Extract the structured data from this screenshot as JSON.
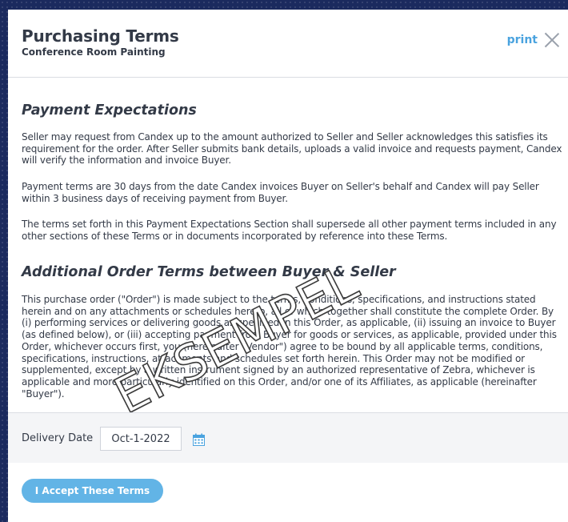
{
  "header": {
    "title": "Purchasing Terms",
    "subtitle": "Conference Room Painting",
    "print_label": "print"
  },
  "sections": [
    {
      "title": "Payment Expectations",
      "paragraphs": [
        "Seller may request from Candex up to the amount authorized to Seller and Seller acknowledges this satisfies its requirement for the order. After Seller submits bank details, uploads a valid invoice and requests payment, Candex will verify the information and invoice Buyer.",
        "Payment terms are 30 days from the date Candex invoices Buyer on Seller's behalf and Candex will pay Seller within 3 business days of receiving payment from Buyer.",
        "The terms set forth in this Payment Expectations Section shall supersede all other payment terms included in any other sections of these Terms or in documents incorporated by reference into these Terms."
      ]
    },
    {
      "title": "Additional Order Terms between Buyer & Seller",
      "paragraphs": [
        "This purchase order (\"Order\") is made subject to the terms, conditions, specifications, and instructions stated herein and on any attachments or schedules hereto, all of which together shall constitute the complete Order. By (i) performing services or delivering goods as specified in this Order, as applicable, (ii) issuing an invoice to Buyer (as defined below), or (iii) accepting payment from Buyer for goods or services, as applicable, provided under this Order, whichever occurs first, you (hereinafter \"Vendor\") agree to be bound by all applicable terms, conditions, specifications, instructions, attachments and schedules set forth herein. This Order may not be modified or supplemented, except by a written instrument signed by an authorized representative of Zebra, whichever is applicable and more particularly identified on this Order, and/or one of its Affiliates, as applicable (hereinafter \"Buyer\")."
      ]
    }
  ],
  "watermark": "EKSEMPEL",
  "delivery": {
    "label": "Delivery Date",
    "value": "Oct-1-2022"
  },
  "footer": {
    "accept_label": "I Accept These Terms"
  },
  "colors": {
    "page_bg": "#1b2a5e",
    "accent": "#4aa3df",
    "button": "#62b4e6",
    "text": "#333a47"
  }
}
